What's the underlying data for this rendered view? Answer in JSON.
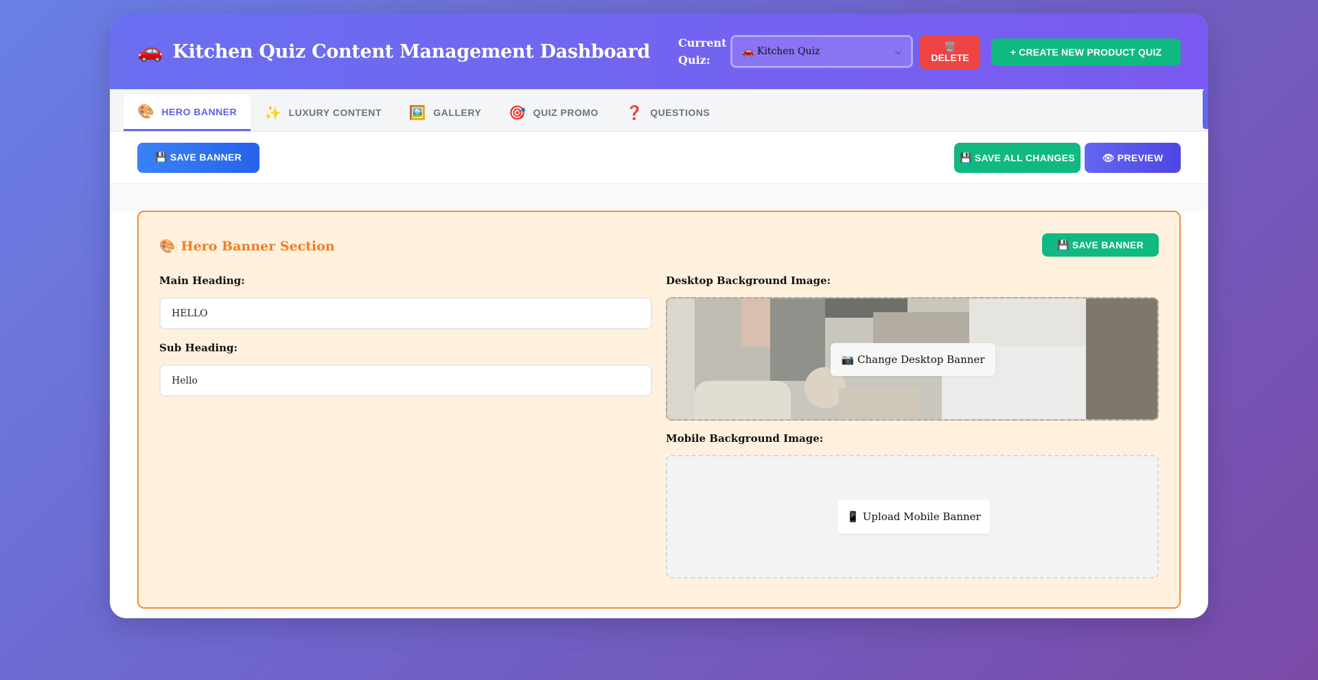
{
  "header": {
    "title_icon": "red-car-icon",
    "title": "Kitchen Quiz Content Management Dashboard",
    "quiz_label": "Current Quiz:",
    "quiz_select_value": "🚗 Kitchen Quiz",
    "delete_icon": "🗑️",
    "delete_label": "DELETE",
    "create_label": "+ CREATE NEW PRODUCT QUIZ"
  },
  "tabs": [
    {
      "icon": "🎨",
      "label": "HERO BANNER",
      "active": true
    },
    {
      "icon": "✨",
      "label": "LUXURY CONTENT",
      "active": false
    },
    {
      "icon": "🖼️",
      "label": "GALLERY",
      "active": false
    },
    {
      "icon": "🎯",
      "label": "QUIZ PROMO",
      "active": false
    },
    {
      "icon": "❓",
      "label": "QUESTIONS",
      "active": false
    }
  ],
  "toolbar": {
    "save_banner_label": "💾 SAVE BANNER",
    "save_all_label": "💾 SAVE ALL CHANGES",
    "preview_label": "👁 PREVIEW"
  },
  "panel": {
    "title_icon": "🎨",
    "title": "Hero Banner Section",
    "save_label": "💾 SAVE BANNER",
    "main_heading_label": "Main Heading:",
    "main_heading_value": "HELLO",
    "sub_heading_label": "Sub Heading:",
    "sub_heading_value": "Hello",
    "desktop_label": "Desktop Background Image:",
    "change_desktop_label": "📷 Change Desktop Banner",
    "mobile_label": "Mobile Background Image:",
    "upload_mobile_label": "📱 Upload Mobile Banner"
  },
  "colors": {
    "accent": "#6366f1",
    "success": "#10b981",
    "danger": "#ef4444",
    "panel_border": "#f58a3a",
    "panel_bg": "#fff1de"
  }
}
